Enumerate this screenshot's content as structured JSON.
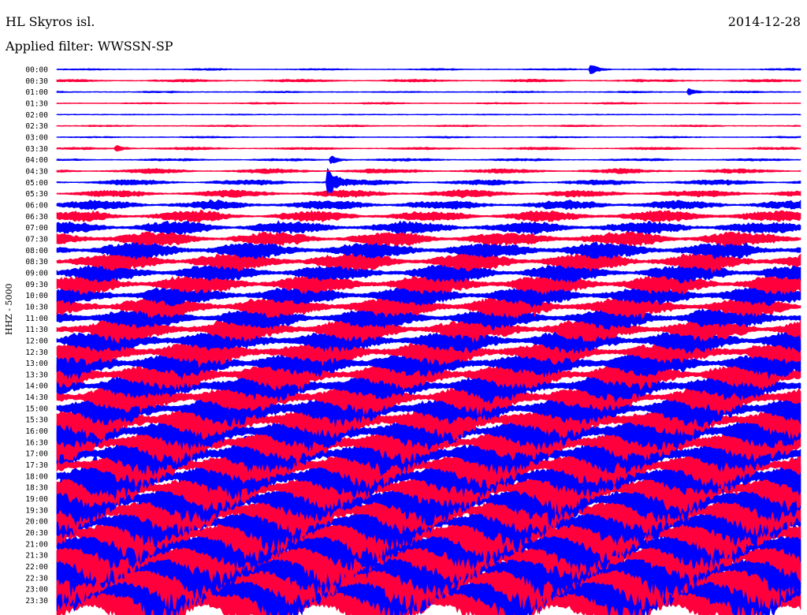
{
  "header": {
    "station": "HL Skyros isl.",
    "date": "2014-12-28",
    "filter": "Applied filter: WWSSN-SP"
  },
  "chart_data": {
    "type": "line",
    "title": "HL Skyros isl.",
    "date": "2014-12-28",
    "subtitle": "Applied filter: WWSSN-SP",
    "ylabel": "HHZ - 5000",
    "xlabel": "",
    "series_colors": [
      "#0000ff",
      "#ff003c"
    ],
    "grid": false,
    "rows": [
      {
        "label": "00:00",
        "amplitude": 1,
        "events": [
          {
            "x": 0.72,
            "amp": 6
          }
        ]
      },
      {
        "label": "00:30",
        "amplitude": 1.5,
        "events": []
      },
      {
        "label": "01:00",
        "amplitude": 1,
        "events": [
          {
            "x": 0.85,
            "amp": 5
          }
        ]
      },
      {
        "label": "01:30",
        "amplitude": 1,
        "events": []
      },
      {
        "label": "02:00",
        "amplitude": 0.6,
        "events": []
      },
      {
        "label": "02:30",
        "amplitude": 1,
        "events": []
      },
      {
        "label": "03:00",
        "amplitude": 1,
        "events": []
      },
      {
        "label": "03:30",
        "amplitude": 1.5,
        "events": [
          {
            "x": 0.08,
            "amp": 4
          }
        ]
      },
      {
        "label": "04:00",
        "amplitude": 1.5,
        "events": [
          {
            "x": 0.37,
            "amp": 5
          }
        ]
      },
      {
        "label": "04:30",
        "amplitude": 2.5,
        "events": []
      },
      {
        "label": "05:00",
        "amplitude": 3,
        "events": [
          {
            "x": 0.365,
            "amp": 18
          }
        ]
      },
      {
        "label": "05:30",
        "amplitude": 4,
        "events": []
      },
      {
        "label": "06:00",
        "amplitude": 5,
        "events": []
      },
      {
        "label": "06:30",
        "amplitude": 6,
        "events": []
      },
      {
        "label": "07:00",
        "amplitude": 7,
        "events": []
      },
      {
        "label": "07:30",
        "amplitude": 8,
        "events": []
      },
      {
        "label": "08:00",
        "amplitude": 9,
        "events": []
      },
      {
        "label": "08:30",
        "amplitude": 10,
        "events": []
      },
      {
        "label": "09:00",
        "amplitude": 10,
        "events": []
      },
      {
        "label": "09:30",
        "amplitude": 11,
        "events": []
      },
      {
        "label": "10:00",
        "amplitude": 11,
        "events": []
      },
      {
        "label": "10:30",
        "amplitude": 12,
        "events": []
      },
      {
        "label": "11:00",
        "amplitude": 12,
        "events": []
      },
      {
        "label": "11:30",
        "amplitude": 13,
        "events": []
      },
      {
        "label": "12:00",
        "amplitude": 13,
        "events": []
      },
      {
        "label": "12:30",
        "amplitude": 14,
        "events": []
      },
      {
        "label": "13:00",
        "amplitude": 15,
        "events": []
      },
      {
        "label": "13:30",
        "amplitude": 16,
        "events": []
      },
      {
        "label": "14:00",
        "amplitude": 17,
        "events": []
      },
      {
        "label": "14:30",
        "amplitude": 18,
        "events": []
      },
      {
        "label": "15:00",
        "amplitude": 19,
        "events": []
      },
      {
        "label": "15:30",
        "amplitude": 20,
        "events": []
      },
      {
        "label": "16:00",
        "amplitude": 21,
        "events": []
      },
      {
        "label": "16:30",
        "amplitude": 22,
        "events": []
      },
      {
        "label": "17:00",
        "amplitude": 23,
        "events": []
      },
      {
        "label": "17:30",
        "amplitude": 24,
        "events": []
      },
      {
        "label": "18:00",
        "amplitude": 25,
        "events": []
      },
      {
        "label": "18:30",
        "amplitude": 26,
        "events": []
      },
      {
        "label": "19:00",
        "amplitude": 27,
        "events": []
      },
      {
        "label": "19:30",
        "amplitude": 28,
        "events": []
      },
      {
        "label": "20:00",
        "amplitude": 29,
        "events": []
      },
      {
        "label": "20:30",
        "amplitude": 30,
        "events": []
      },
      {
        "label": "21:00",
        "amplitude": 31,
        "events": []
      },
      {
        "label": "21:30",
        "amplitude": 32,
        "events": []
      },
      {
        "label": "22:00",
        "amplitude": 33,
        "events": []
      },
      {
        "label": "22:30",
        "amplitude": 34,
        "events": []
      },
      {
        "label": "23:00",
        "amplitude": 35,
        "events": []
      },
      {
        "label": "23:30",
        "amplitude": 36,
        "events": []
      }
    ]
  }
}
